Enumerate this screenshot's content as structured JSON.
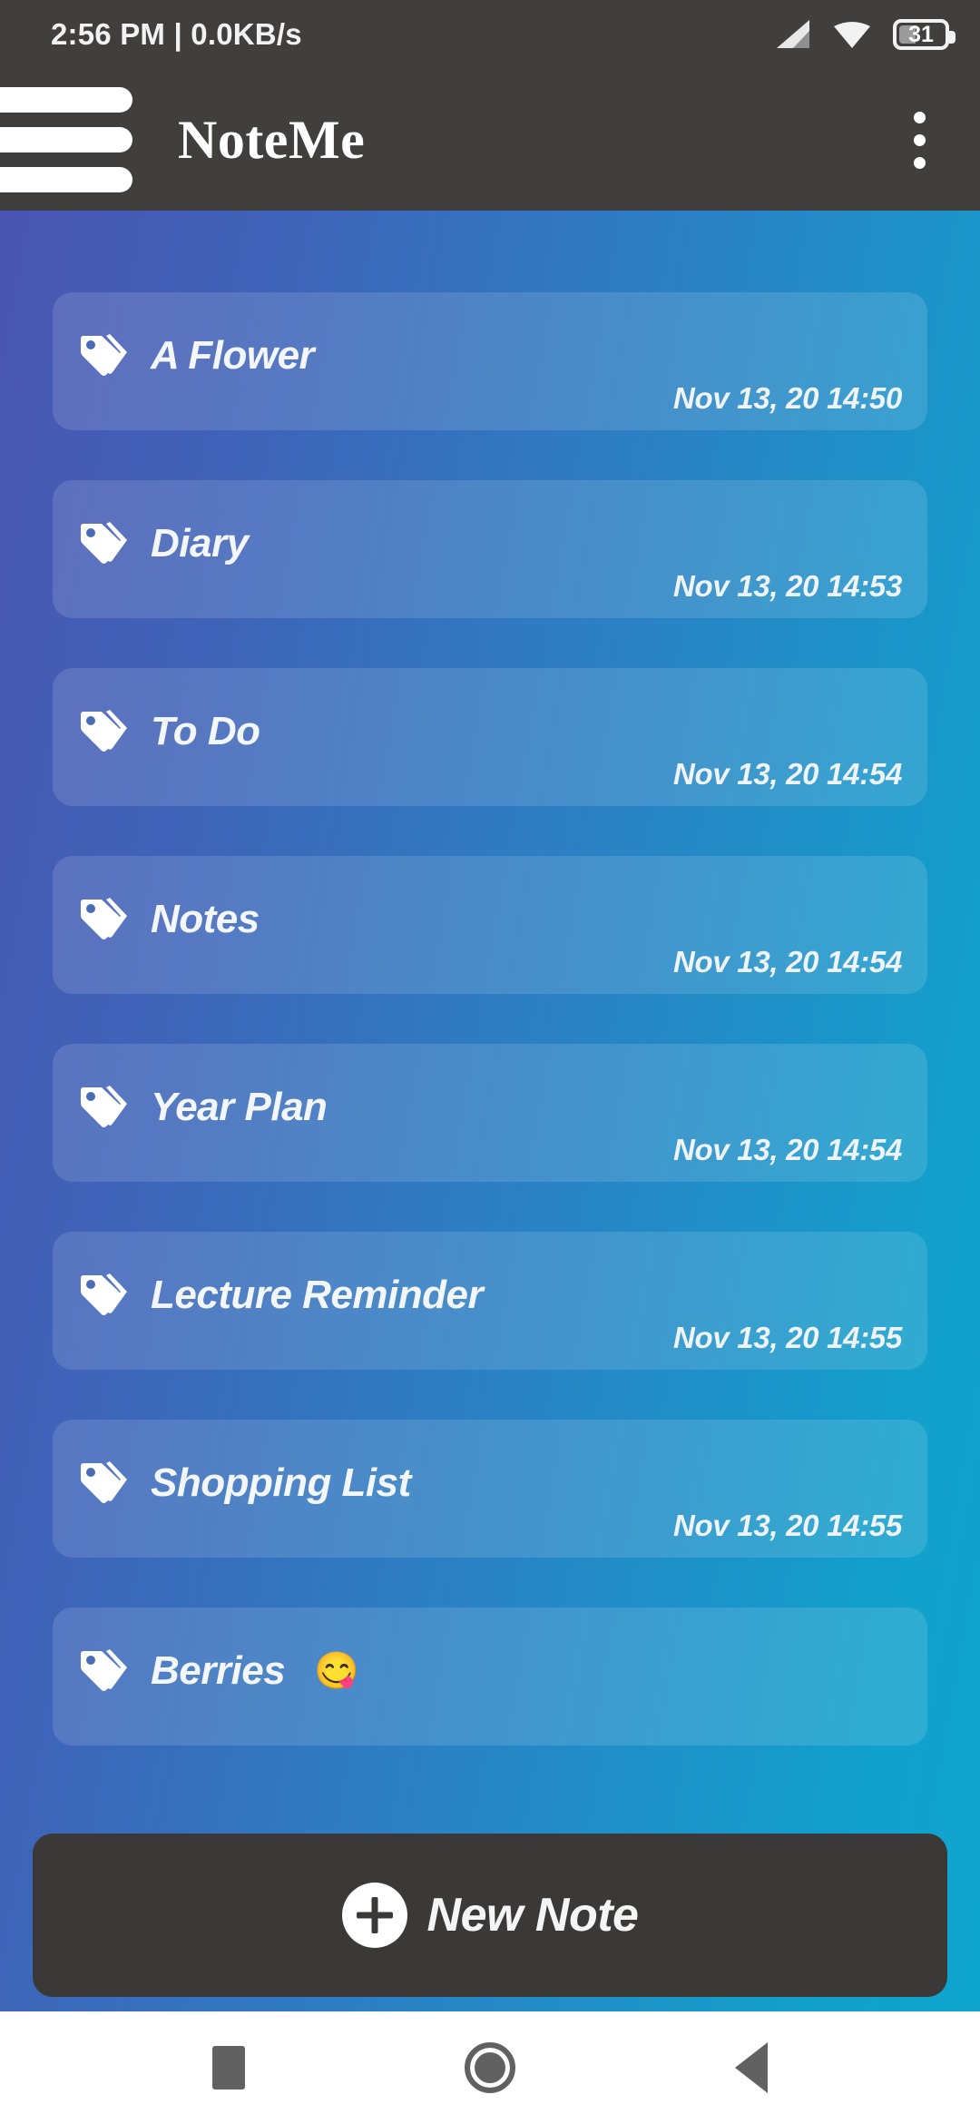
{
  "status_bar": {
    "left_text": "2:56 PM | 0.0KB/s",
    "signal_icon": "signal-bars-icon",
    "wifi_icon": "wifi-icon",
    "battery_icon": "battery-icon",
    "battery_level": "31"
  },
  "app_bar": {
    "menu_icon": "hamburger-menu-icon",
    "title": "NoteMe",
    "overflow_icon": "overflow-menu-icon"
  },
  "theme": {
    "gradient_start": "#4a56b2",
    "gradient_end": "#0ea6cf",
    "bar_color": "#403f3e",
    "card_overlay": "rgba(255,255,255,0.13)",
    "text_color": "#f3f7fb"
  },
  "notes": [
    {
      "icon": "tag-icon",
      "title": "A Flower",
      "emoji": "",
      "date": "Nov 13, 20 14:50"
    },
    {
      "icon": "tag-icon",
      "title": "Diary",
      "emoji": "",
      "date": "Nov 13, 20 14:53"
    },
    {
      "icon": "tag-icon",
      "title": "To Do",
      "emoji": "",
      "date": "Nov 13, 20 14:54"
    },
    {
      "icon": "tag-icon",
      "title": "Notes",
      "emoji": "",
      "date": "Nov 13, 20 14:54"
    },
    {
      "icon": "tag-icon",
      "title": "Year Plan",
      "emoji": "",
      "date": "Nov 13, 20 14:54"
    },
    {
      "icon": "tag-icon",
      "title": "Lecture Reminder",
      "emoji": "",
      "date": "Nov 13, 20 14:55"
    },
    {
      "icon": "tag-icon",
      "title": "Shopping List",
      "emoji": "",
      "date": "Nov 13, 20 14:55"
    },
    {
      "icon": "tag-icon",
      "title": "Berries",
      "emoji": "😋",
      "date": ""
    }
  ],
  "new_note_button": {
    "label": "New Note",
    "icon": "plus-circle-icon"
  },
  "nav_bar": {
    "recents_icon": "recents-square-icon",
    "home_icon": "home-circle-icon",
    "back_icon": "back-triangle-icon"
  }
}
